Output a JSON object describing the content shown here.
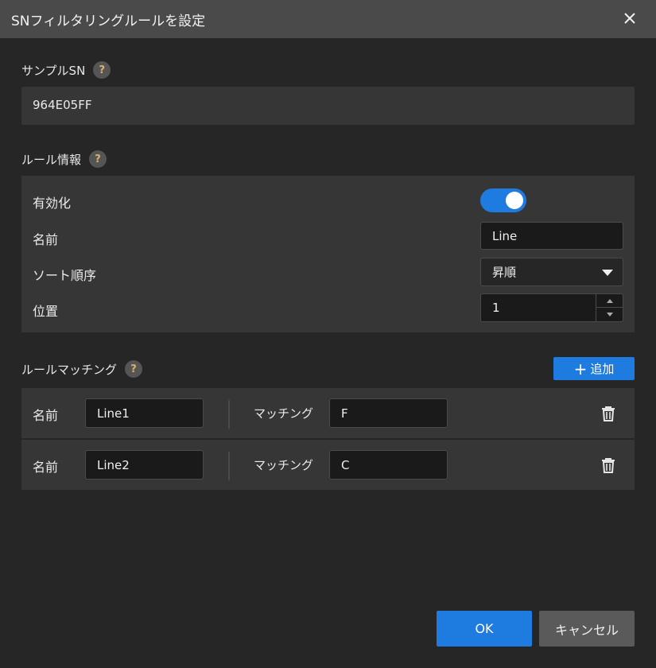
{
  "dialog": {
    "title": "SNフィルタリングルールを設定",
    "close_icon": "close-icon"
  },
  "sample": {
    "label": "サンプルSN",
    "value": "964E05FF"
  },
  "rule_info": {
    "label": "ルール情報",
    "enable_label": "有効化",
    "enabled": true,
    "name_label": "名前",
    "name_value": "Line",
    "sort_label": "ソート順序",
    "sort_value": "昇順",
    "position_label": "位置",
    "position_value": "1"
  },
  "matching": {
    "label": "ルールマッチング",
    "add_label": "追加",
    "rows": [
      {
        "name_label": "名前",
        "name_value": "Line1",
        "match_label": "マッチング",
        "match_value": "F"
      },
      {
        "name_label": "名前",
        "name_value": "Line2",
        "match_label": "マッチング",
        "match_value": "C"
      }
    ]
  },
  "help_mark": "?",
  "footer": {
    "ok_label": "OK",
    "cancel_label": "キャンセル"
  },
  "colors": {
    "accent": "#1e7be0",
    "background": "#262626",
    "panel": "#363636",
    "titlebar": "#4a4a4a"
  }
}
